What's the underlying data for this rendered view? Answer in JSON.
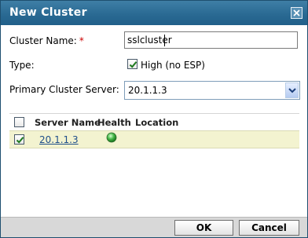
{
  "dialog": {
    "title": "New Cluster"
  },
  "form": {
    "cluster_name_label": "Cluster Name:",
    "required_marker": "*",
    "cluster_name_value": "sslcluster",
    "type_label": "Type:",
    "type_option_label": "High (no ESP)",
    "type_option_checked": true,
    "primary_server_label": "Primary Cluster Server:",
    "primary_server_value": "20.1.1.3"
  },
  "table": {
    "columns": [
      "Server Name",
      "Health",
      "Location"
    ],
    "rows": [
      {
        "server_name": "20.1.1.3",
        "health": "green-status-icon",
        "location": "",
        "checked": true
      }
    ]
  },
  "buttons": {
    "ok": "OK",
    "cancel": "Cancel"
  },
  "colors": {
    "titlebar": "#2a6a93",
    "selected_row": "#f3f3d0",
    "link": "#1f4f8a",
    "required": "#cc0000",
    "health_green": "#3daa3d"
  }
}
